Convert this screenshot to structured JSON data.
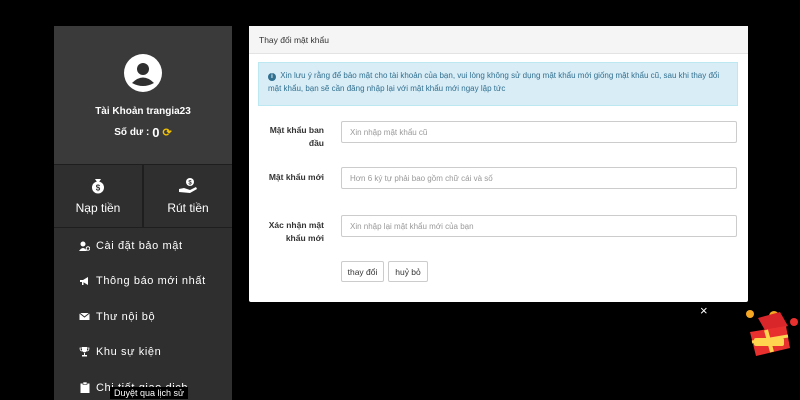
{
  "profile": {
    "account_label": "Tài Khoản trangia23",
    "balance_label": "Số dư :",
    "balance_value": "0"
  },
  "actions": {
    "deposit": "Nạp tiền",
    "withdraw": "Rút tiền"
  },
  "menu": [
    {
      "label": "Cài đặt bảo mật",
      "icon": "user-gear-icon"
    },
    {
      "label": "Thông báo mới nhất",
      "icon": "bullhorn-icon"
    },
    {
      "label": "Thư nội bộ",
      "icon": "envelope-icon"
    },
    {
      "label": "Khu sự kiện",
      "icon": "trophy-icon"
    },
    {
      "label": "Chi tiết giao dịch",
      "icon": "clipboard-icon"
    }
  ],
  "panel": {
    "title": "Thay đổi mật khẩu",
    "info": "Xin lưu ý rằng để bảo mật cho tài khoản của bạn, vui lòng không sử dụng mật khẩu mới giống mật khẩu cũ, sau khi thay đổi mật khẩu, bạn sẽ cần đăng nhập lại với mật khẩu mới ngay lập tức",
    "fields": [
      {
        "label": "Mật khẩu ban đầu",
        "placeholder": "Xin nhập mật khẩu cũ"
      },
      {
        "label": "Mật khẩu mới",
        "placeholder": "Hơn 6 ký tự phải bao gồm chữ cái và số"
      },
      {
        "label": "Xác nhận mật khẩu mới",
        "placeholder": "Xin nhập lại mật khẩu mới của bạn"
      }
    ],
    "submit": "thay đổi",
    "cancel": "huỷ bỏ"
  },
  "tooltip": "Duyệt qua lịch sử",
  "close_symbol": "×",
  "colors": {
    "sidebar": "#2f2f2f",
    "info_bg": "#d9edf7",
    "info_text": "#31708f",
    "refresh": "#f2c200"
  }
}
